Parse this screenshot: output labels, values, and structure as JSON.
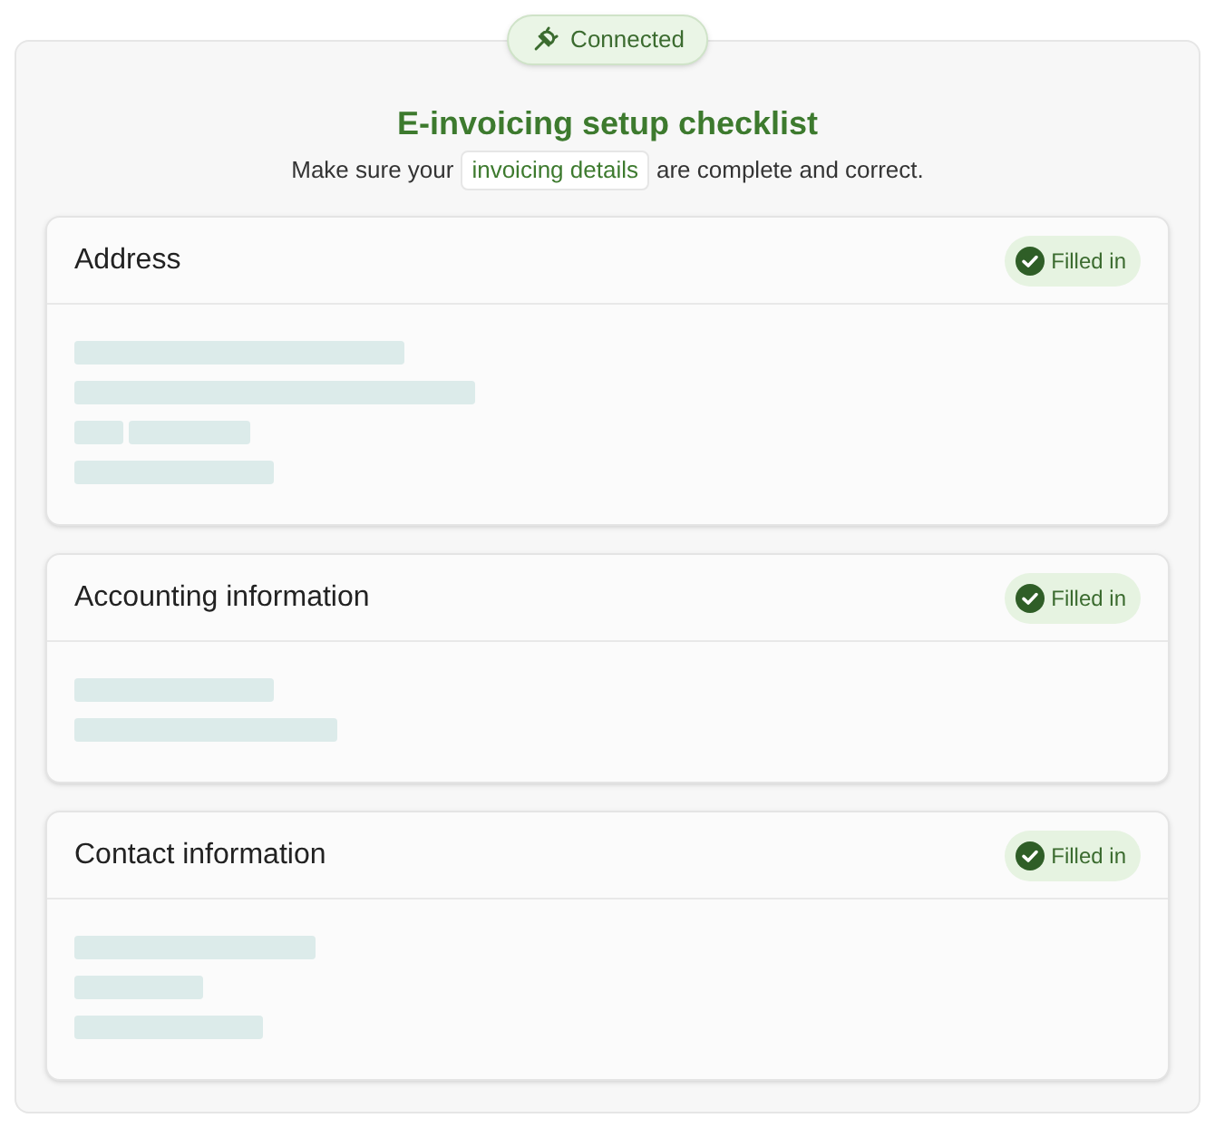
{
  "connection_badge": {
    "label": "Connected"
  },
  "title": "E-invoicing setup checklist",
  "subtitle": {
    "before": "Make sure your",
    "link": "invoicing details",
    "after": "are complete and correct."
  },
  "sections": [
    {
      "title": "Address",
      "filled": true,
      "badge": "Filled in"
    },
    {
      "title": "Accounting information",
      "filled": true,
      "badge": "Filled in"
    },
    {
      "title": "Contact information",
      "filled": true,
      "badge": "Filled in"
    }
  ]
}
